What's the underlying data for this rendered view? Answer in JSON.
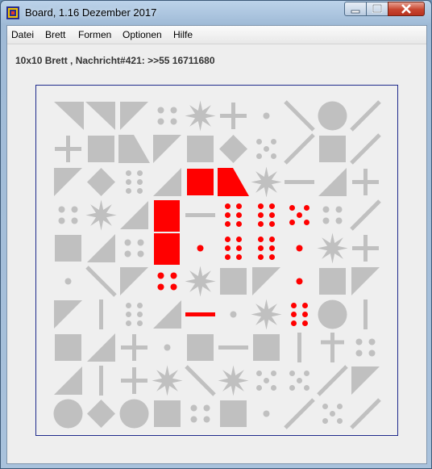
{
  "window": {
    "title": "Board, 1.16 Dezember 2017",
    "icons": {
      "app": "board-app-icon",
      "minimize": "minimize-icon",
      "maximize": "maximize-icon",
      "close": "close-icon"
    }
  },
  "menu": [
    {
      "label": "Datei"
    },
    {
      "label": "Brett"
    },
    {
      "label": "Formen"
    },
    {
      "label": "Optionen"
    },
    {
      "label": "Hilfe"
    }
  ],
  "status_label": "10x10 Brett , Nachricht#421: >>55 16711680",
  "board": {
    "grid": 10,
    "colors": {
      "inactive": "#c0c0c0",
      "highlight": "#ff0000",
      "border": "#1f2a8c",
      "background": "#efefef"
    },
    "cells": [
      [
        "tri-lr",
        "tri-tl-tr",
        "tri-tl-tl",
        "dots-4",
        "star",
        "cross",
        "dot",
        "line-diag-a",
        "circle",
        "line-diag-b"
      ],
      [
        "cross",
        "square",
        "tri-wide",
        "tri-tl-tl",
        "square",
        "diamond",
        "dots-5",
        "line-diag-b",
        "square",
        "line-diag-b"
      ],
      [
        "tri-bl",
        "diamond",
        "dots-6",
        "tri-br",
        "square",
        "tri-wide",
        "star",
        "line-h",
        "tri-br",
        "cross"
      ],
      [
        "dots-4",
        "star",
        "tri-br",
        "bar-v",
        "line-h",
        "dots-6",
        "dots-6",
        "dots-5",
        "dots-4",
        "line-diag-b"
      ],
      [
        "square",
        "tri-br",
        "dots-4",
        "bar-v",
        "dot",
        "dots-6",
        "dots-6",
        "dot",
        "star",
        "cross"
      ],
      [
        "dot",
        "line-diag-a",
        "tri-tr",
        "dots-4",
        "star",
        "square",
        "tri-tr",
        "dot",
        "square",
        "tri-tl-tl"
      ],
      [
        "tri-tl-bl",
        "line-v",
        "dots-6",
        "tri-br",
        "line-h",
        "dot",
        "star",
        "dots-6",
        "circle",
        "line-v"
      ],
      [
        "square",
        "tri-br",
        "cross",
        "dot",
        "square",
        "line-h",
        "square",
        "line-v",
        "line-v-cross",
        "dots-4"
      ],
      [
        "tri-br",
        "line-v",
        "cross",
        "star",
        "line-diag-a",
        "star",
        "dots-5",
        "dots-5",
        "line-diag-b",
        "tri-tr"
      ],
      [
        "circle",
        "diamond",
        "circle",
        "square",
        "dots-4",
        "square",
        "dot",
        "line-diag-b",
        "dots-5",
        "line-diag-b"
      ]
    ],
    "highlighted": [
      "2,4",
      "2,5",
      "3,3",
      "3,5",
      "3,6",
      "3,7",
      "4,3",
      "4,4",
      "4,5",
      "4,6",
      "4,7",
      "5,3",
      "5,7",
      "6,4",
      "6,7"
    ]
  }
}
